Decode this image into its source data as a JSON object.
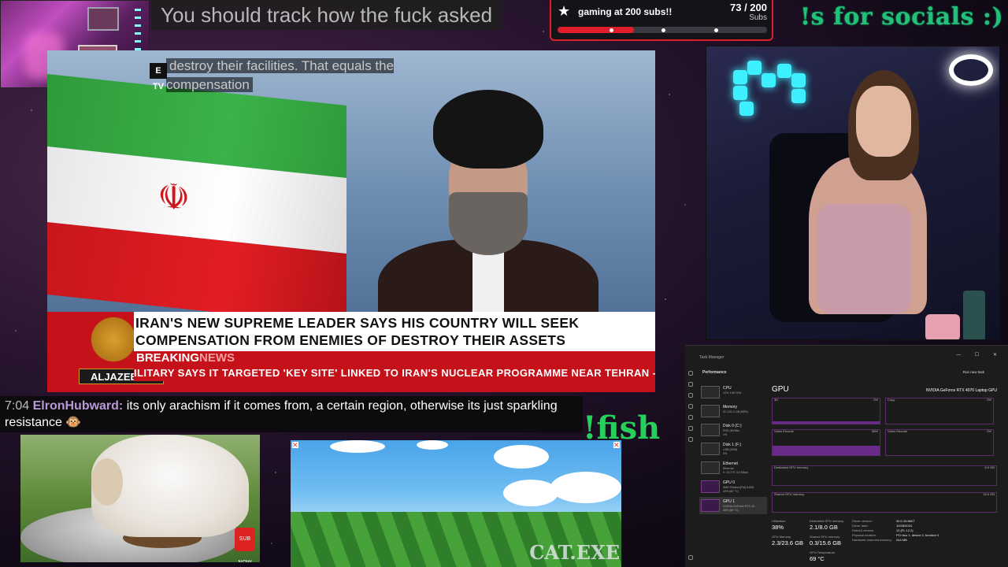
{
  "top_caption": "You should track how the fuck asked",
  "subgoal": {
    "title": "gaming at 200 subs!!",
    "count": "73 / 200",
    "unit": "Subs",
    "progress": 0.365,
    "accent": "#e01e2a"
  },
  "socials_command": "!s for socials :)",
  "news": {
    "tv_tag": "E TV",
    "caption": "destroy their facilities. That equals the compensation",
    "emblem": "☫",
    "headline_line1": "IRAN'S NEW SUPREME LEADER SAYS HIS COUNTRY WILL SEEK",
    "headline_line2": "COMPENSATION FROM ENEMIES OF DESTROY THEIR ASSETS",
    "breaking_word1": "BREAKING",
    "breaking_word2": "NEWS",
    "network": "ALJAZEERA",
    "ticker": "ILITARY SAYS IT TARGETED 'KEY SITE' LINKED TO IRAN'S NUCLEAR PROGRAMME NEAR TEHRAN  -  REPOR",
    "brand_color": "#c5121a"
  },
  "chat": {
    "time": "7:04",
    "user": "ElronHubward:",
    "message": "its only arachism if it comes from, a certain region, otherwise its just sparkling resistance 🐵"
  },
  "fish_command": "!fish",
  "game_label": "CAT.EXE",
  "puppy_sub_badge": "SUB NOW",
  "taskmgr": {
    "window_title": "Task Manager",
    "window_buttons": "— ☐ ✕",
    "section": "Performance",
    "run_new_task": "Run new task",
    "items": [
      {
        "name": "CPU",
        "sub": "12%  1.69 GHz"
      },
      {
        "name": "Memory",
        "sub": "22.1/31.2 GB (68%)"
      },
      {
        "name": "Disk 0 (C:)",
        "sub": "SSD (NVMe)\n1%"
      },
      {
        "name": "Disk 1 (F:)",
        "sub": "USB (USB)\n0%"
      },
      {
        "name": "Ethernet",
        "sub": "Ethernet\nS: 20.2  R: 3.9 Mbps"
      },
      {
        "name": "GPU 0",
        "sub": "AMD Radeon(TM) 610M\n40% (60 °C)"
      },
      {
        "name": "GPU 1",
        "sub": "NVIDIA GeForce RTX 40...\n38% (69 °C)"
      }
    ],
    "gpu_title": "GPU",
    "gpu_model": "NVIDIA GeForce RTX 4070 Laptop GPU",
    "graphs": [
      {
        "label": "3D",
        "pct": "0%",
        "level": 0.08
      },
      {
        "label": "Copy",
        "pct": "0%",
        "level": 0.0
      },
      {
        "label": "Video Encode",
        "pct": "38%",
        "level": 0.38
      },
      {
        "label": "Video Decode",
        "pct": "0%",
        "level": 0.0
      }
    ],
    "dedicated_label": "Dedicated GPU memory",
    "dedicated_max": "8.0 GB",
    "shared_label": "Shared GPU memory",
    "shared_max": "15.6 GB",
    "utilization_label": "Utilization",
    "utilization": "38%",
    "dedicated_mem_label": "Dedicated GPU memory",
    "dedicated_mem": "2.1/8.0 GB",
    "gpu_mem_label": "GPU Memory",
    "gpu_mem": "2.3/23.6 GB",
    "shared_mem_label": "Shared GPU memory",
    "shared_mem": "0.3/15.6 GB",
    "temp_label": "GPU Temperature",
    "temp": "69 °C",
    "details": [
      {
        "k": "Driver version:",
        "v": "32.0.15.6607"
      },
      {
        "k": "Driver date:",
        "v": "10/28/2024"
      },
      {
        "k": "DirectX version:",
        "v": "12 (FL 12.2)"
      },
      {
        "k": "Physical location:",
        "v": "PCI bus 1, device 0, function 0"
      },
      {
        "k": "Hardware reserved memory:",
        "v": "244 MB"
      }
    ]
  }
}
